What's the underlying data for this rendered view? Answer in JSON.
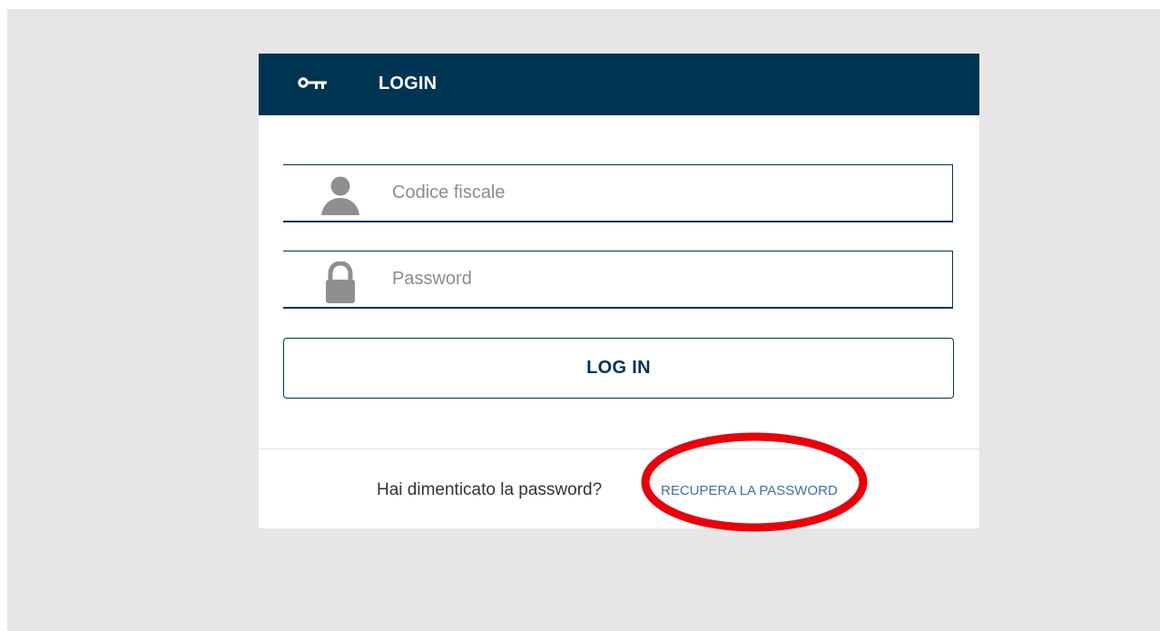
{
  "login_panel": {
    "title": "LOGIN",
    "title_icon": "key-icon",
    "header_color": "#003453"
  },
  "fields": {
    "fiscal_code": {
      "placeholder": "Codice fiscale",
      "value": "",
      "icon": "user-icon"
    },
    "password": {
      "placeholder": "Password",
      "value": "",
      "icon": "lock-icon"
    }
  },
  "login_button": {
    "label": "LOG IN"
  },
  "forgot_password": {
    "question": "Hai dimenticato la password?",
    "link_label": "RECUPERA LA PASSWORD",
    "link_color": "#3f6fa6"
  },
  "annotation": {
    "type": "highlight-ellipse",
    "color": "#e8000b",
    "target": "forgot-password-link"
  }
}
